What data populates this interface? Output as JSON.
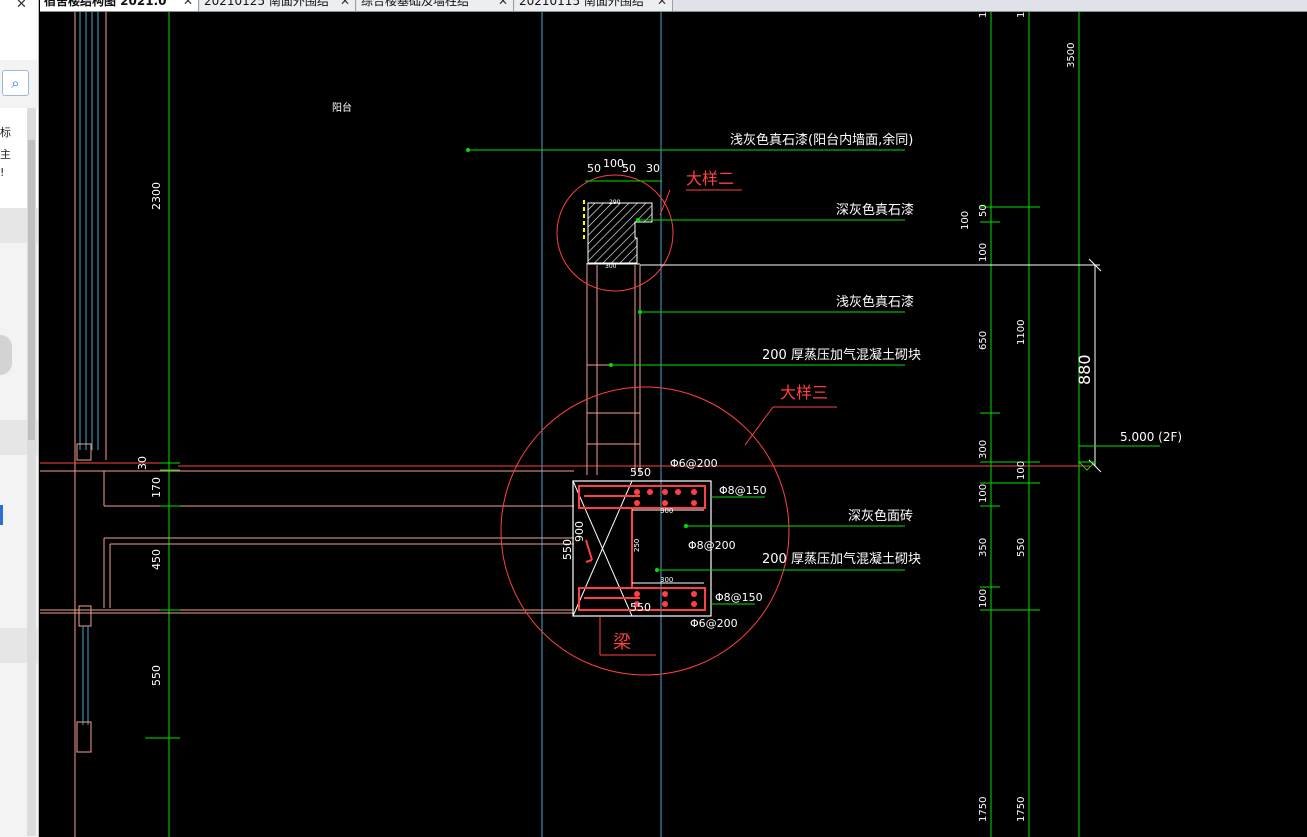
{
  "app": {
    "tabs": [
      {
        "label": "宿舍楼结构图 2021.0",
        "active": true
      },
      {
        "label": "20210125 南面外围结",
        "active": false
      },
      {
        "label": "综合楼基础及墙柱结",
        "active": false
      },
      {
        "label": "20210115 南面外围结",
        "active": false
      }
    ],
    "side_panel": {
      "search_icon": "search-icon",
      "text_lines": [
        "标",
        "主",
        "!"
      ]
    }
  },
  "drawing": {
    "title_balcony": "阳台",
    "annotations": {
      "light_gray_stone_inner": "浅灰色真石漆(阳台内墙面,余同)",
      "dark_gray_stone": "深灰色真石漆",
      "light_gray_stone": "浅灰色真石漆",
      "block_200_top": "200  厚蒸压加气混凝土砌块",
      "dark_gray_tile": "深灰色面砖",
      "block_200_bottom": "200  厚蒸压加气混凝土砌块",
      "detail_2": "大样二",
      "detail_3": "大样三",
      "beam": "梁",
      "elevation": "5.000   (2F)"
    },
    "dims_top": [
      "50",
      "100",
      "50",
      "30"
    ],
    "dims_section": [
      "550",
      "550",
      "300",
      "250",
      "300",
      "300",
      "550",
      "900",
      "290"
    ],
    "rebar": [
      "Φ6@200",
      "Φ8@150",
      "Φ8@200",
      "Φ8@150",
      "Φ6@200"
    ],
    "dims_left": [
      "2300",
      "30",
      "170",
      "450",
      "550"
    ],
    "dims_right_a": [
      "100",
      "50",
      "100",
      "650",
      "300",
      "100",
      "350",
      "100",
      "1750"
    ],
    "dims_right_b": [
      "1",
      "1",
      "3500",
      "1100",
      "100",
      "550",
      "1750"
    ],
    "dim_880": "880",
    "colors": {
      "background": "#000000",
      "green": "#00ff00",
      "red": "#ff4040",
      "white": "#ffffff",
      "cyan": "#4aa3c8",
      "salmon": "#f0a090",
      "yellow": "#ffff00"
    }
  }
}
